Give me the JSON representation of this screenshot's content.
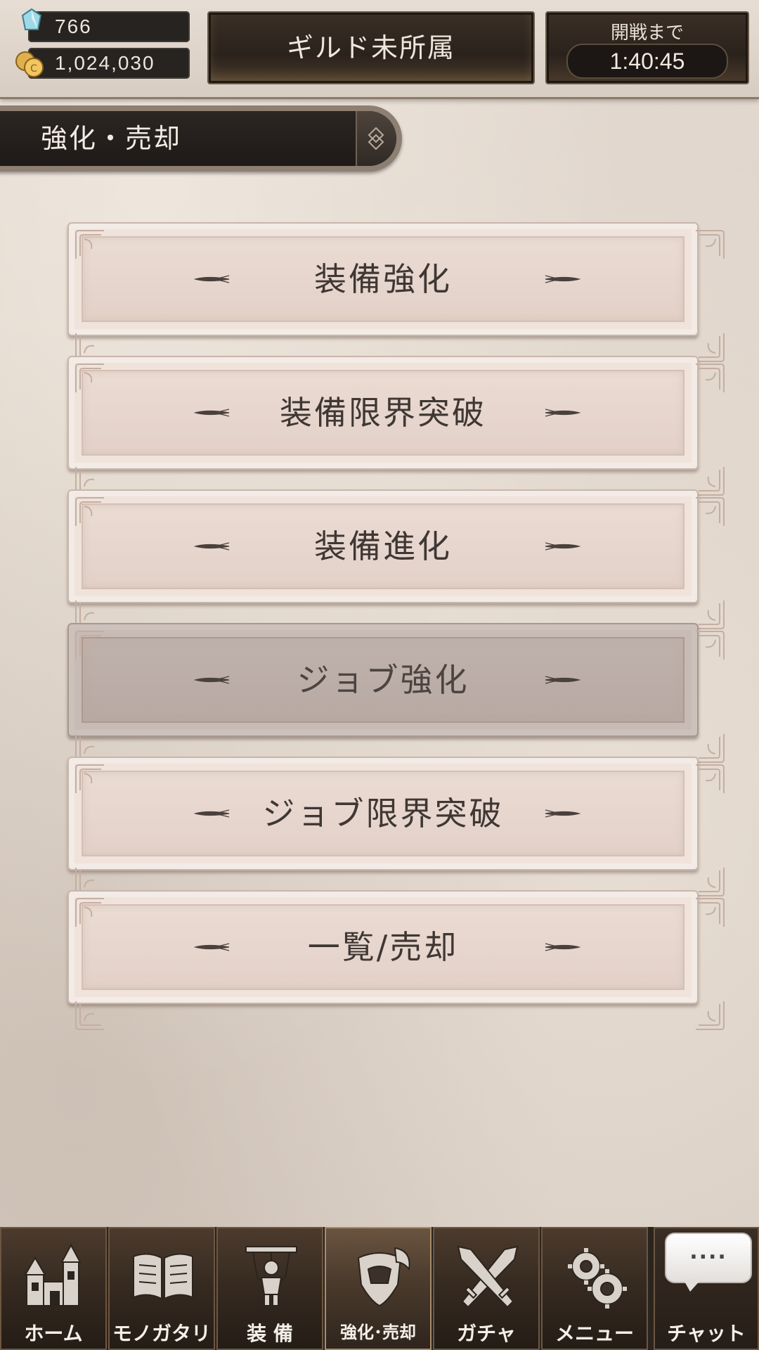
{
  "header": {
    "gems": "766",
    "coins": "1,024,030",
    "guild_status": "ギルド未所属",
    "battle_label": "開戦まで",
    "battle_timer": "1:40:45"
  },
  "section": {
    "title": "強化・売却"
  },
  "menu": [
    {
      "label": "装備強化",
      "enabled": true
    },
    {
      "label": "装備限界突破",
      "enabled": true
    },
    {
      "label": "装備進化",
      "enabled": true
    },
    {
      "label": "ジョブ強化",
      "enabled": false
    },
    {
      "label": "ジョブ限界突破",
      "enabled": true
    },
    {
      "label": "一覧/売却",
      "enabled": true
    }
  ],
  "nav": [
    {
      "label": "ホーム",
      "icon": "castle-icon"
    },
    {
      "label": "モノガタリ",
      "icon": "book-icon"
    },
    {
      "label": "装 備",
      "icon": "marionette-icon"
    },
    {
      "label": "強化･売却",
      "icon": "shield-helmet-icon",
      "active": true
    },
    {
      "label": "ガチャ",
      "icon": "crossed-swords-icon"
    },
    {
      "label": "メニュー",
      "icon": "gears-icon"
    }
  ],
  "chat": {
    "bubble": "....",
    "label": "チャット"
  },
  "colors": {
    "background": "#d9cfc6",
    "button_face": "#eadbd3",
    "button_disabled": "#bfb1ab",
    "nav_bg": "#372b21"
  }
}
